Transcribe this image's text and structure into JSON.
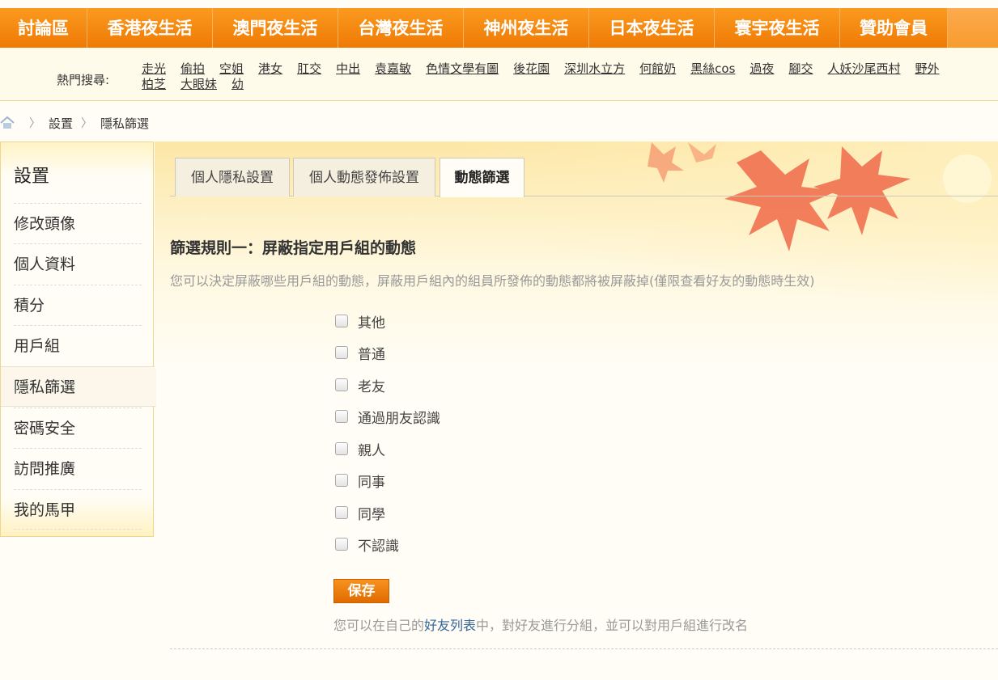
{
  "topnav": {
    "items": [
      {
        "label": "討論區"
      },
      {
        "label": "香港夜生活"
      },
      {
        "label": "澳門夜生活"
      },
      {
        "label": "台灣夜生活"
      },
      {
        "label": "神州夜生活"
      },
      {
        "label": "日本夜生活"
      },
      {
        "label": "寰宇夜生活"
      },
      {
        "label": "贊助會員"
      }
    ]
  },
  "hot_search": {
    "label": "熱門搜尋:",
    "links": [
      "走光",
      "偷拍",
      "空姐",
      "港女",
      "肛交",
      "中出",
      "袁嘉敏",
      "色情文學有圖",
      "後花園",
      "深圳水立方",
      "何館奶",
      "黑絲cos",
      "過夜",
      "腳交",
      "人妖",
      "沙尾西村",
      "野外",
      "柏芝",
      "大眼妹",
      "幼"
    ]
  },
  "breadcrumb": {
    "items": [
      "設置",
      "隱私篩選"
    ],
    "separator": "〉"
  },
  "sidebar": {
    "title": "設置",
    "items": [
      {
        "label": "修改頭像"
      },
      {
        "label": "個人資料"
      },
      {
        "label": "積分"
      },
      {
        "label": "用戶組"
      },
      {
        "label": "隱私篩選"
      },
      {
        "label": "密碼安全"
      },
      {
        "label": "訪問推廣"
      },
      {
        "label": "我的馬甲"
      }
    ],
    "active": "隱私篩選"
  },
  "tabs": [
    {
      "label": "個人隱私設置"
    },
    {
      "label": "個人動態發佈設置"
    },
    {
      "label": "動態篩選"
    }
  ],
  "filter": {
    "title": "篩選規則一：屏蔽指定用戶組的動態",
    "description": "您可以決定屏蔽哪些用戶組的動態，屏蔽用戶組內的組員所發佈的動態都將被屏蔽掉(僅限查看好友的動態時生效)",
    "groups": [
      {
        "label": "其他",
        "checked": false
      },
      {
        "label": "普通",
        "checked": false
      },
      {
        "label": "老友",
        "checked": false
      },
      {
        "label": "通過朋友認識",
        "checked": false
      },
      {
        "label": "親人",
        "checked": false
      },
      {
        "label": "同事",
        "checked": false
      },
      {
        "label": "同學",
        "checked": false
      },
      {
        "label": "不認識",
        "checked": false
      }
    ],
    "save_label": "保存",
    "hint_before": "您可以在自己的",
    "hint_link": "好友列表",
    "hint_after": "中，對好友進行分組，並可以對用戶組進行改名"
  },
  "colors": {
    "nav_orange": "#f08a12",
    "link_blue": "#336699",
    "save_button": "#ee7d0c"
  }
}
